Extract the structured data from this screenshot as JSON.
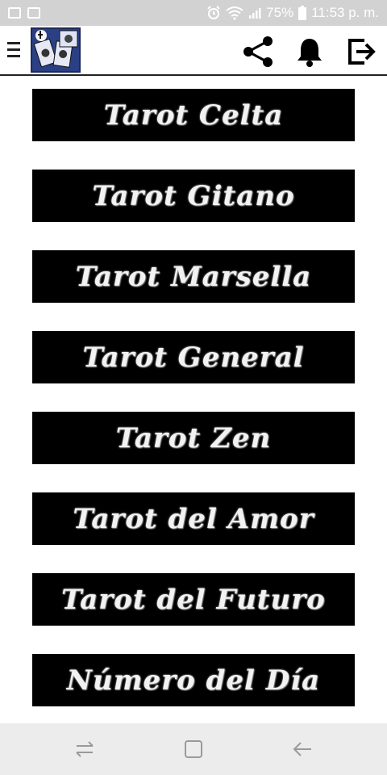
{
  "status_bar": {
    "battery": "75%",
    "time": "11:53 p. m.",
    "icons": [
      "image-icon",
      "activity-icon",
      "alarm-icon",
      "wifi-icon",
      "signal-icon",
      "battery-icon"
    ]
  },
  "app_bar": {
    "icons": [
      "menu-icon",
      "app-logo",
      "share-icon",
      "bell-icon",
      "exit-icon"
    ]
  },
  "menu": {
    "items": [
      {
        "label": "Tarot Celta"
      },
      {
        "label": "Tarot Gitano"
      },
      {
        "label": "Tarot Marsella"
      },
      {
        "label": "Tarot General"
      },
      {
        "label": "Tarot Zen"
      },
      {
        "label": "Tarot del Amor"
      },
      {
        "label": "Tarot del Futuro"
      },
      {
        "label": "Número del Día"
      }
    ]
  },
  "nav_bar": {
    "icons": [
      "recents-icon",
      "home-icon",
      "back-icon"
    ]
  },
  "colors": {
    "button_bg": "#000000",
    "button_text": "#f2f2f2",
    "status_bar": "#d2d2d2",
    "nav_bar": "#ececec"
  }
}
